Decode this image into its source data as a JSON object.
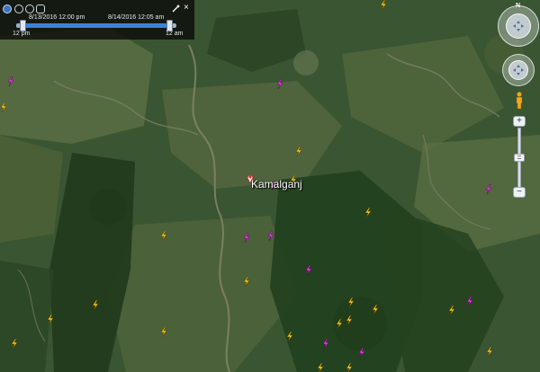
{
  "map": {
    "place_label": "Kamalganj",
    "feature_colors": {
      "strike_recent": "#e637e6",
      "strike_older": "#f2c21b"
    }
  },
  "time_slider": {
    "start_label": "8/13/2016  12:00 pm",
    "end_label": "8/14/2016  12:05 am",
    "left_tick": "12 pm",
    "right_tick": "12 am"
  },
  "nav": {
    "north_label": "N",
    "zoom_in": "+",
    "zoom_out": "−"
  },
  "icons": {
    "strike": "lightning-bolt-icon",
    "place": "place-pin-icon",
    "pegman": "street-view-pegman-icon"
  }
}
